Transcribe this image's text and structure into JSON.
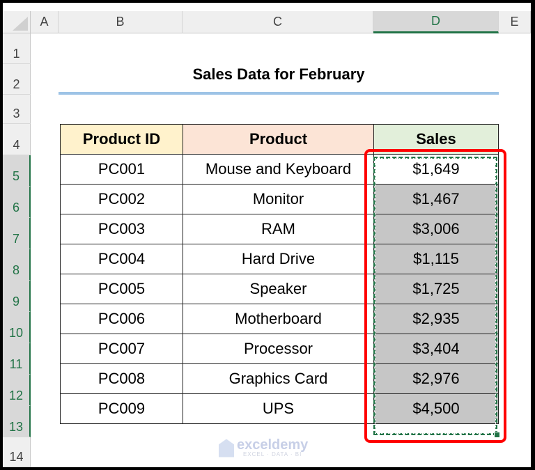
{
  "columns": [
    "A",
    "B",
    "C",
    "D",
    "E"
  ],
  "selected_column": "D",
  "rows": [
    "1",
    "2",
    "3",
    "4",
    "5",
    "6",
    "7",
    "8",
    "9",
    "10",
    "11",
    "12",
    "13",
    "14"
  ],
  "title": "Sales Data for February",
  "table": {
    "headers": [
      "Product ID",
      "Product",
      "Sales"
    ],
    "rows": [
      [
        "PC001",
        "Mouse and Keyboard",
        "$1,649"
      ],
      [
        "PC002",
        "Monitor",
        "$1,467"
      ],
      [
        "PC003",
        "RAM",
        "$3,006"
      ],
      [
        "PC004",
        "Hard Drive",
        "$1,115"
      ],
      [
        "PC005",
        "Speaker",
        "$1,725"
      ],
      [
        "PC006",
        "Motherboard",
        "$2,935"
      ],
      [
        "PC007",
        "Processor",
        "$3,404"
      ],
      [
        "PC008",
        "Graphics Card",
        "$2,976"
      ],
      [
        "PC009",
        "UPS",
        "$4,500"
      ]
    ]
  },
  "colors": {
    "header_product_id": "#fff2cc",
    "header_product": "#fce4d6",
    "header_sales": "#e2efda",
    "selection_gray": "#c6c6c6",
    "excel_green": "#217346",
    "highlight_red": "#ff0000"
  },
  "watermark": {
    "name": "exceldemy",
    "tagline": "EXCEL · DATA · BI"
  }
}
